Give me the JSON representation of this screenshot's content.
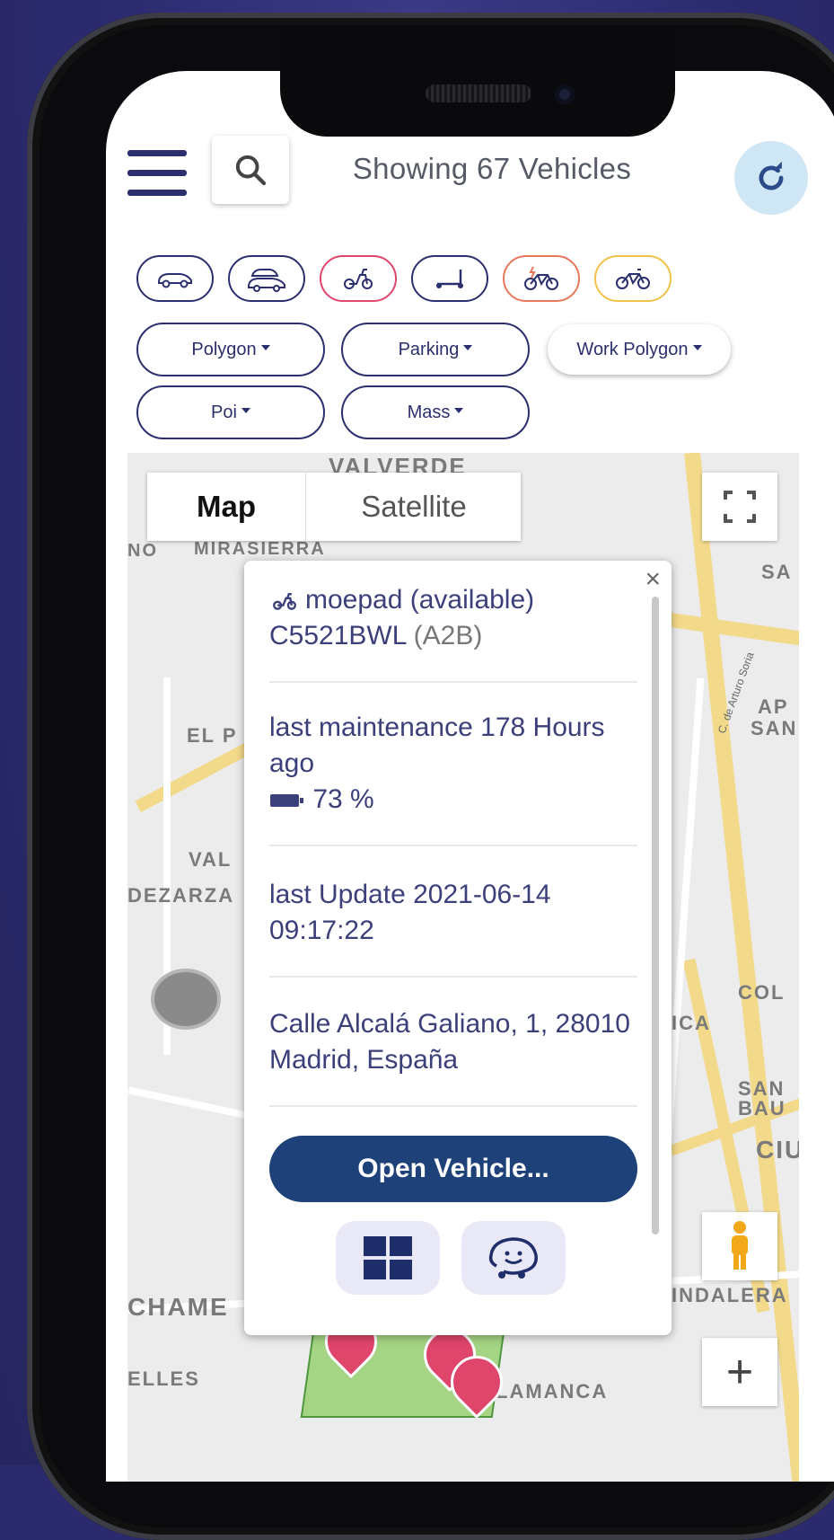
{
  "header": {
    "title": "Showing 67 Vehicles"
  },
  "vehicle_types": [
    {
      "icon": "car-icon",
      "color": "#2c2f6e"
    },
    {
      "icon": "cars-icon",
      "color": "#2c2f6e"
    },
    {
      "icon": "moped-icon",
      "color": "#e0456c"
    },
    {
      "icon": "scooter-icon",
      "color": "#2c2f6e"
    },
    {
      "icon": "ebike-icon",
      "color": "#e8785a"
    },
    {
      "icon": "bike-icon",
      "color": "#f0c24a"
    }
  ],
  "filters": {
    "polygon": "Polygon",
    "parking": "Parking",
    "work_polygon": "Work Polygon",
    "poi": "Poi",
    "mass": "Mass"
  },
  "map": {
    "tab_map": "Map",
    "tab_satellite": "Satellite",
    "labels": {
      "valverde": "VALVERDE",
      "mirasierra": "MIRASIERRA",
      "no": "NO",
      "sa": "SA",
      "el_p": "EL P",
      "val": "VAL",
      "dezarza": "DEZARZA",
      "ap": "AP",
      "san": "SAN",
      "arturo": "C. de Arturo Soria",
      "col": "COL",
      "ica": "ICA",
      "san_bau": "SAN",
      "bau": "BAU",
      "ciu": "CIU",
      "chame": "CHAME",
      "indalera": "INDALERA",
      "elles": "ELLES",
      "lamanca": "LAMANCA"
    },
    "zoom_in": "+"
  },
  "popup": {
    "close": "×",
    "vehicle_model": "moepad (available)",
    "plate": "C5521BWL",
    "plate_suffix": "(A2B)",
    "maintenance": "last maintenance 178 Hours ago",
    "battery": "73 %",
    "last_update": "last Update 2021-06-14 09:17:22",
    "address": "Calle Alcalá Galiano, 1, 28010 Madrid, España",
    "open_button": "Open Vehicle..."
  },
  "colors": {
    "brand": "#2c2f6e",
    "open_button": "#1d4178",
    "refresh_bg": "#cfe6f5",
    "background": "#2b2a6e"
  }
}
